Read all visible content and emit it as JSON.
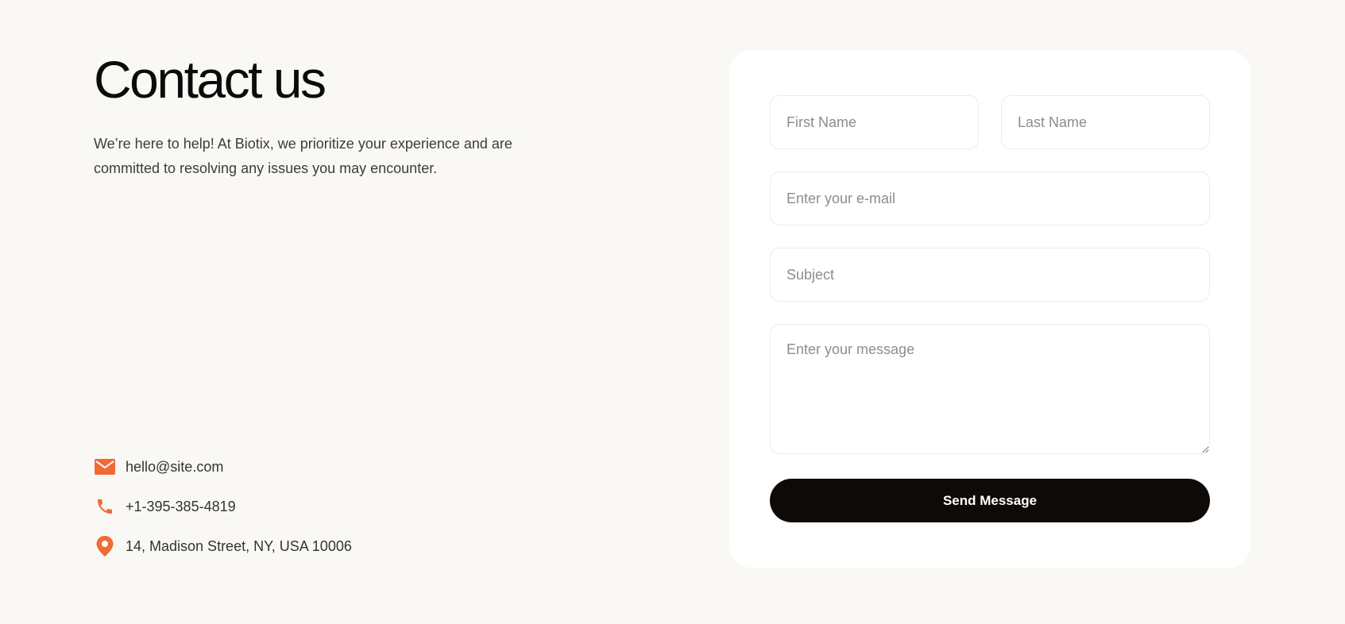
{
  "header": {
    "title": "Contact us",
    "intro": "We’re here to help! At Biotix, we prioritize your experience and are committed to resolving any issues you may encounter."
  },
  "contacts": [
    {
      "icon": "mail-icon",
      "text": "hello@site.com"
    },
    {
      "icon": "phone-icon",
      "text": "+1-395-385-4819"
    },
    {
      "icon": "location-pin-icon",
      "text": "14, Madison Street, NY, USA 10006"
    }
  ],
  "form": {
    "first_name_placeholder": "First Name",
    "last_name_placeholder": "Last Name",
    "email_placeholder": "Enter your e-mail",
    "subject_placeholder": "Subject",
    "message_placeholder": "Enter your message",
    "submit_label": "Send Message"
  },
  "colors": {
    "page_background": "#faf8f5",
    "card_background": "#ffffff",
    "accent": "#f06a35",
    "button": "#0d0a08"
  }
}
